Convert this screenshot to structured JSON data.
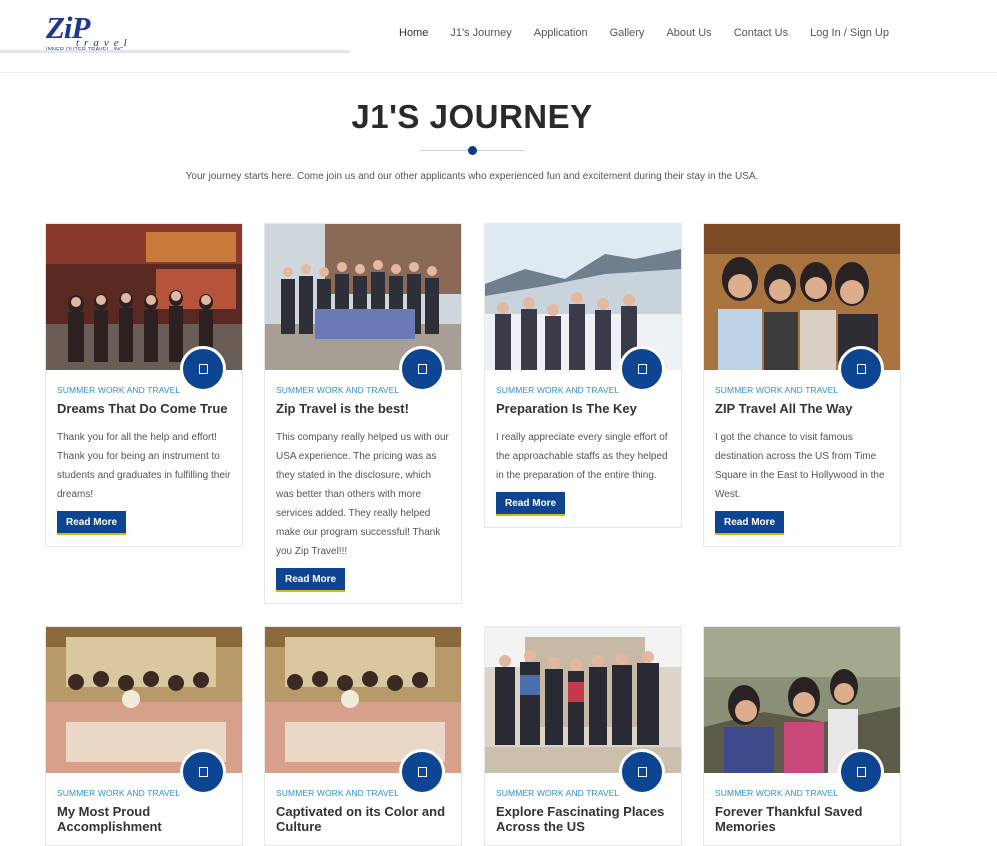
{
  "logo": {
    "main": "ZiP",
    "sub": "travel",
    "tag": "INNER OUTER TRAVEL, INC."
  },
  "nav": [
    "Home",
    "J1's Journey",
    "Application",
    "Gallery",
    "About Us",
    "Contact Us",
    "Log In / Sign Up"
  ],
  "page": {
    "title": "J1'S JOURNEY",
    "intro": "Your journey starts here. Come join us and our other applicants who experienced fun and excitement during their stay in the USA."
  },
  "read_more": "Read More",
  "cards": [
    {
      "category": "SUMMER WORK AND TRAVEL",
      "title": "Dreams That Do Come True",
      "text": "Thank you for all the help and effort! Thank you for being an instrument to students and graduates in fulfilling their dreams!"
    },
    {
      "category": "SUMMER WORK AND TRAVEL",
      "title": "Zip Travel is the best!",
      "text": "This company really helped us with our USA experience. The pricing was as they stated in the disclosure, which was better than others with more services added. They really helped make our program successful! Thank you Zip Travel!!!"
    },
    {
      "category": "SUMMER WORK AND TRAVEL",
      "title": "Preparation Is The Key",
      "text": "I really appreciate every single effort of the approachable staffs as they helped in the preparation of the entire thing."
    },
    {
      "category": "SUMMER WORK AND TRAVEL",
      "title": "ZIP Travel All The Way",
      "text": "I got the chance to visit famous destination across the US from Time Square in the East to Hollywood in the West."
    },
    {
      "category": "SUMMER WORK AND TRAVEL",
      "title": "My Most Proud Accomplishment"
    },
    {
      "category": "SUMMER WORK AND TRAVEL",
      "title": "Captivated on its Color and Culture"
    },
    {
      "category": "SUMMER WORK AND TRAVEL",
      "title": "Explore Fascinating Places Across the US"
    },
    {
      "category": "SUMMER WORK AND TRAVEL",
      "title": "Forever Thankful Saved Memories"
    }
  ],
  "colors": {
    "brand": "#0d4592",
    "category": "#2f8fd8",
    "button_underline": "#e0b800"
  }
}
